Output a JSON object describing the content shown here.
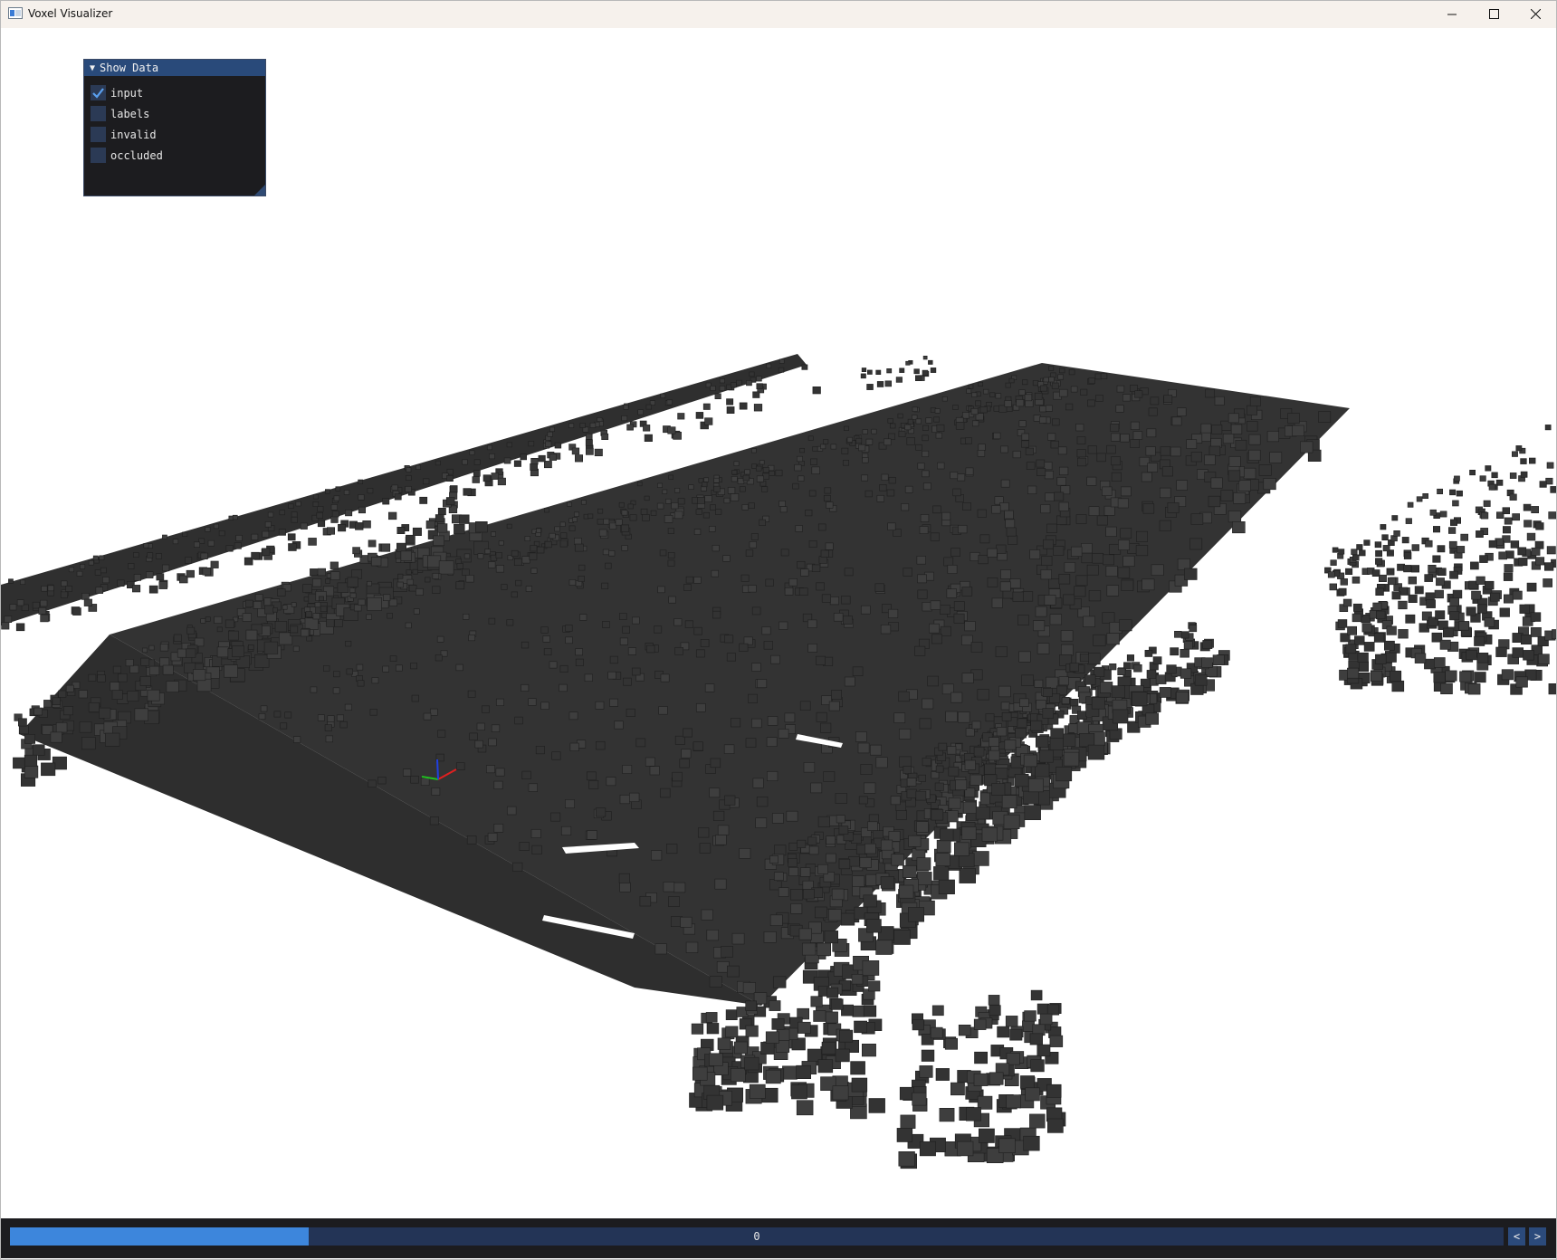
{
  "window": {
    "title": "Voxel Visualizer",
    "controls": [
      "minimize-icon",
      "maximize-icon",
      "close-icon"
    ]
  },
  "panel": {
    "title": "Show Data",
    "options": [
      {
        "label": "input",
        "checked": true
      },
      {
        "label": "labels",
        "checked": false
      },
      {
        "label": "invalid",
        "checked": false
      },
      {
        "label": "occluded",
        "checked": false
      }
    ]
  },
  "frame_slider": {
    "value": "0",
    "fill_fraction": 0.2,
    "prev_label": "<",
    "next_label": ">"
  },
  "colors": {
    "voxel": "#333333",
    "voxel_edge": "#1e1e1e",
    "axis_x": "#e02020",
    "axis_y": "#20c020",
    "axis_z": "#2040e0",
    "accent": "#3d86dc"
  }
}
